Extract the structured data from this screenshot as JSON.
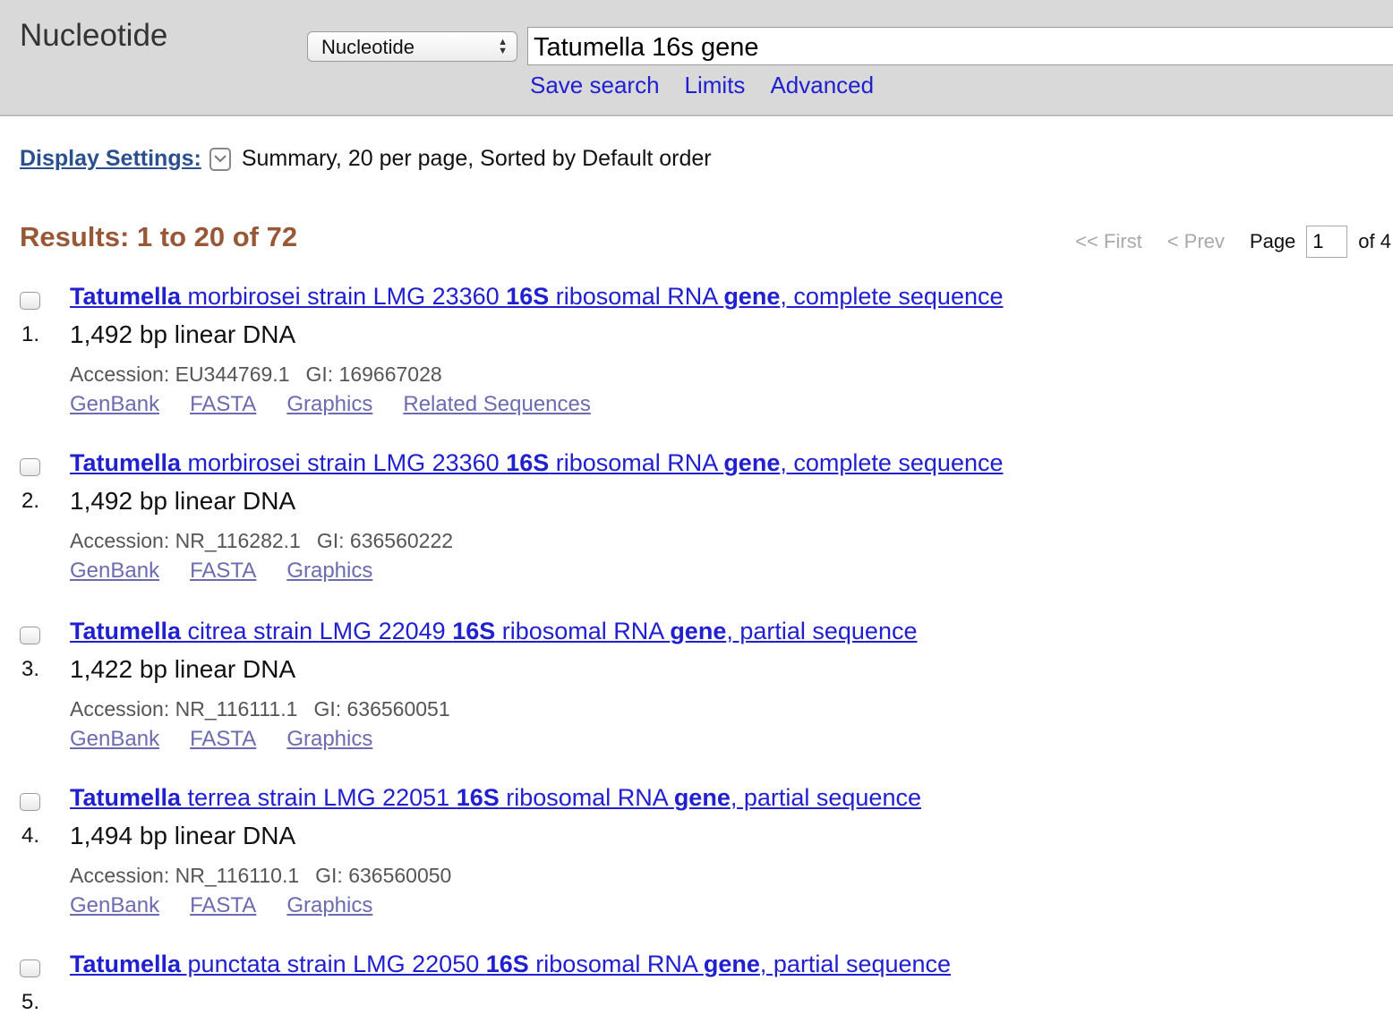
{
  "header": {
    "db_title": "Nucleotide",
    "db_select_value": "Nucleotide",
    "search_value": "Tatumella 16s gene",
    "links": [
      "Save search",
      "Limits",
      "Advanced"
    ]
  },
  "display_settings": {
    "label": "Display Settings:",
    "summary": "Summary, 20 per page, Sorted by Default order"
  },
  "results_count": "Results: 1 to 20 of 72",
  "pager": {
    "first": "<< First",
    "prev": "< Prev",
    "page_label": "Page",
    "page_value": "1",
    "of": "of 4"
  },
  "results": [
    {
      "num": "1.",
      "title": {
        "a": "Tatumella",
        "b": " morbirosei strain LMG 23360 ",
        "c": "16S",
        "d": " ribosomal RNA ",
        "e": "gene",
        "f": ", complete sequence"
      },
      "desc": "1,492 bp linear DNA",
      "accession": "Accession: EU344769.1",
      "gi": "GI: 169667028",
      "links": [
        "GenBank",
        "FASTA",
        "Graphics",
        "Related Sequences"
      ]
    },
    {
      "num": "2.",
      "title": {
        "a": "Tatumella",
        "b": " morbirosei strain LMG 23360 ",
        "c": "16S",
        "d": " ribosomal RNA ",
        "e": "gene",
        "f": ", complete sequence"
      },
      "desc": "1,492 bp linear DNA",
      "accession": "Accession: NR_116282.1",
      "gi": "GI: 636560222",
      "links": [
        "GenBank",
        "FASTA",
        "Graphics"
      ]
    },
    {
      "num": "3.",
      "title": {
        "a": "Tatumella",
        "b": " citrea strain LMG 22049 ",
        "c": "16S",
        "d": " ribosomal RNA ",
        "e": "gene",
        "f": ", partial sequence"
      },
      "desc": "1,422 bp linear DNA",
      "accession": "Accession: NR_116111.1",
      "gi": "GI: 636560051",
      "links": [
        "GenBank",
        "FASTA",
        "Graphics"
      ]
    },
    {
      "num": "4.",
      "title": {
        "a": "Tatumella",
        "b": " terrea strain LMG 22051 ",
        "c": "16S",
        "d": " ribosomal RNA ",
        "e": "gene",
        "f": ", partial sequence"
      },
      "desc": "1,494 bp linear DNA",
      "accession": "Accession: NR_116110.1",
      "gi": "GI: 636560050",
      "links": [
        "GenBank",
        "FASTA",
        "Graphics"
      ]
    },
    {
      "num": "5.",
      "title": {
        "a": "Tatumella",
        "b": " punctata strain LMG 22050 ",
        "c": "16S",
        "d": " ribosomal RNA ",
        "e": "gene",
        "f": ", partial sequence"
      }
    }
  ]
}
